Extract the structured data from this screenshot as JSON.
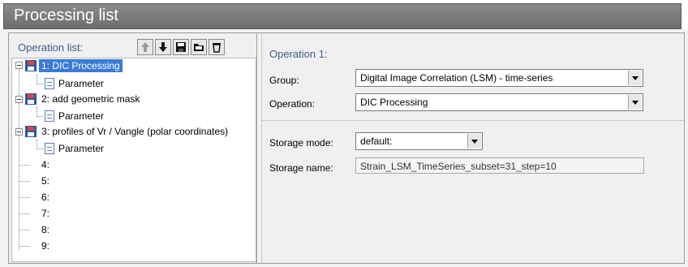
{
  "window": {
    "title": "Processing list"
  },
  "left_panel": {
    "label": "Operation list:",
    "toolbar": [
      {
        "name": "move-up-button",
        "icon": "arrow-up-icon"
      },
      {
        "name": "move-down-button",
        "icon": "arrow-down-icon"
      },
      {
        "name": "save-button",
        "icon": "floppy-icon"
      },
      {
        "name": "open-button",
        "icon": "folder-icon"
      },
      {
        "name": "delete-button",
        "icon": "trash-icon"
      }
    ],
    "tree": {
      "items": [
        {
          "label": "1: DIC Processing",
          "child": "Parameter",
          "selected": true
        },
        {
          "label": "2: add geometric mask",
          "child": "Parameter"
        },
        {
          "label": "3: profiles of Vr / Vangle (polar coordinates)",
          "child": "Parameter"
        },
        {
          "label": "4:"
        },
        {
          "label": "5:"
        },
        {
          "label": "6:"
        },
        {
          "label": "7:"
        },
        {
          "label": "8:"
        },
        {
          "label": "9:"
        }
      ]
    }
  },
  "right_panel": {
    "heading": "Operation 1:",
    "group_label": "Group:",
    "group_value": "Digital Image Correlation (LSM) - time-series",
    "operation_label": "Operation:",
    "operation_value": "DIC Processing",
    "storage_mode_label": "Storage mode:",
    "storage_mode_value": "default:",
    "storage_name_label": "Storage name:",
    "storage_name_value": "Strain_LSM_TimeSeries_subset=31_step=10"
  },
  "colors": {
    "accent": "#3a7bd5",
    "heading": "#3c5c8c",
    "titlebar": "#7a7a7a"
  }
}
